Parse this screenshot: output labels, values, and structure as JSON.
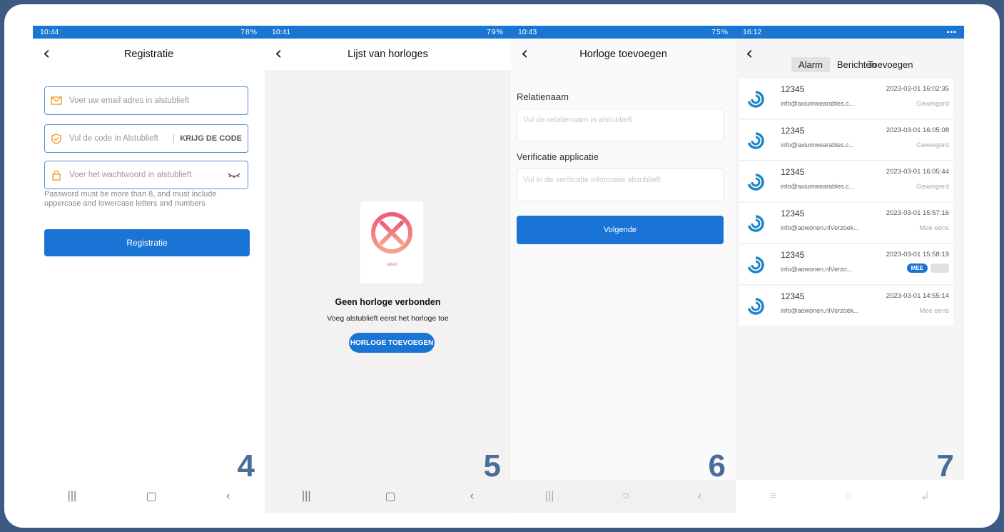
{
  "phone4": {
    "status_time": "10:44",
    "status_right": "78%",
    "title": "Registratie",
    "email_placeholder": "Voer uw email adres in alstublieft",
    "code_placeholder": "Vul de code in Alstublieft",
    "code_button": "KRIJG DE CODE",
    "password_placeholder": "Voer het wachtwoord in alstublieft",
    "password_hint": "Password must be more than 8, and must include uppercase and lowercase letters and numbers",
    "submit_label": "Registratie",
    "step_number": "4"
  },
  "phone5": {
    "status_time": "10:41",
    "status_right": "79%",
    "title": "Lijst van horloges",
    "failed_text": "failed",
    "empty_title": "Geen horloge verbonden",
    "empty_subtitle": "Voeg alstublieft eerst het horloge toe",
    "add_button": "HORLOGE TOEVOEGEN",
    "step_number": "5"
  },
  "phone6": {
    "status_time": "10:43",
    "status_right": "75%",
    "title": "Horloge toevoegen",
    "relation_label": "Relatienaam",
    "relation_placeholder": "Vul de relatienaam in alstublieft",
    "verification_label": "Verificatie applicatie",
    "verification_placeholder": "Vul in de verificatie informatie alstublieft",
    "next_button": "Volgende",
    "step_number": "6"
  },
  "phone7": {
    "status_time": "16:12",
    "tabs": [
      "Alarm",
      "Berichten",
      "Toevoegen"
    ],
    "messages": [
      {
        "name": "12345",
        "date": "2023-03-01 16:02:35",
        "email": "info@axiumwearables.c...",
        "status": "Geweigerd"
      },
      {
        "name": "12345",
        "date": "2023-03-01 16:05:08",
        "email": "info@axiumwearables.c...",
        "status": "Geweigerd"
      },
      {
        "name": "12345",
        "date": "2023-03-01 16:05:44",
        "email": "info@axiumwearables.c...",
        "status": "Geweigerd"
      },
      {
        "name": "12345",
        "date": "2023-03-01 15:57:16",
        "email": "info@aowonen.nlVerzoek...",
        "status": "Mee eens"
      },
      {
        "name": "12345",
        "date": "2023-03-01 15:58:19",
        "email": "info@aowonen.nlVerzo...",
        "status": "MEE"
      },
      {
        "name": "12345",
        "date": "2023-03-01 14:55:14",
        "email": "info@aowonen.nlVerzoek...",
        "status": "Mee eens"
      }
    ],
    "step_number": "7"
  },
  "colors": {
    "accent": "#1a74d6",
    "frame": "#3c5a82",
    "number": "#4a6e99"
  },
  "icons": {
    "back": "chevron-left-icon",
    "email": "envelope-icon",
    "code": "shield-icon",
    "password": "lock-icon",
    "eye": "eye-closed-icon"
  }
}
